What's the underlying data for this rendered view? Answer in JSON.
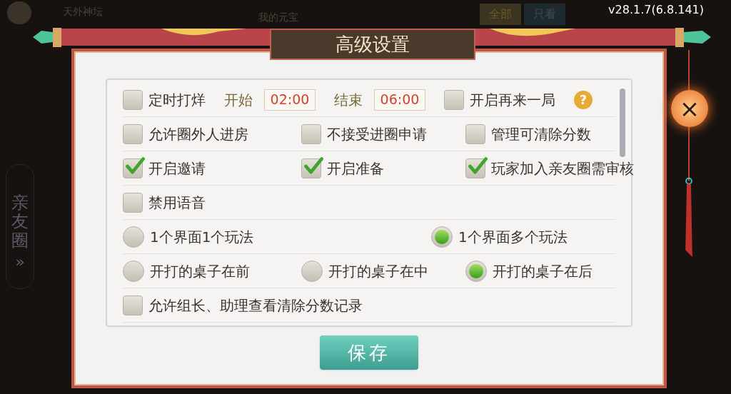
{
  "background": {
    "club_name": "天外神坛",
    "currency_label": "我的元宝",
    "filter_tabs": [
      {
        "label": "全部",
        "selected": true
      },
      {
        "label": "只看",
        "selected": false
      }
    ],
    "side_tab": "亲友圈",
    "side_arrow": "»"
  },
  "version": "v28.1.7(6.8.141)",
  "dialog": {
    "title": "高级设置",
    "rows": [
      {
        "items": [
          {
            "kind": "checkbox",
            "label": "定时打烊",
            "checked": false
          },
          {
            "kind": "time",
            "label": "开始",
            "value": "02:00"
          },
          {
            "kind": "time",
            "label": "结束",
            "value": "06:00"
          },
          {
            "kind": "checkbox",
            "label": "开启再来一局",
            "checked": false
          },
          {
            "kind": "help",
            "label": "?"
          }
        ]
      },
      {
        "items": [
          {
            "kind": "checkbox",
            "label": "允许圈外人进房",
            "checked": false
          },
          {
            "kind": "checkbox",
            "label": "不接受进圈申请",
            "checked": false
          },
          {
            "kind": "checkbox",
            "label": "管理可清除分数",
            "checked": false
          }
        ]
      },
      {
        "items": [
          {
            "kind": "checkbox",
            "label": "开启邀请",
            "checked": true
          },
          {
            "kind": "checkbox",
            "label": "开启准备",
            "checked": true
          },
          {
            "kind": "checkbox",
            "label": "玩家加入亲友圈需审核",
            "checked": true
          }
        ]
      },
      {
        "items": [
          {
            "kind": "checkbox",
            "label": "禁用语音",
            "checked": false
          }
        ]
      },
      {
        "items": [
          {
            "kind": "radio",
            "label": "1个界面1个玩法",
            "selected": false
          },
          {
            "kind": "radio",
            "label": "1个界面多个玩法",
            "selected": true
          }
        ]
      },
      {
        "items": [
          {
            "kind": "radio",
            "label": "开打的桌子在前",
            "selected": false
          },
          {
            "kind": "radio",
            "label": "开打的桌子在中",
            "selected": false
          },
          {
            "kind": "radio",
            "label": "开打的桌子在后",
            "selected": true
          }
        ]
      },
      {
        "items": [
          {
            "kind": "checkbox",
            "label": "允许组长、助理查看清除分数记录",
            "checked": false
          }
        ]
      }
    ],
    "save_button": "保存",
    "close_button": "×"
  }
}
